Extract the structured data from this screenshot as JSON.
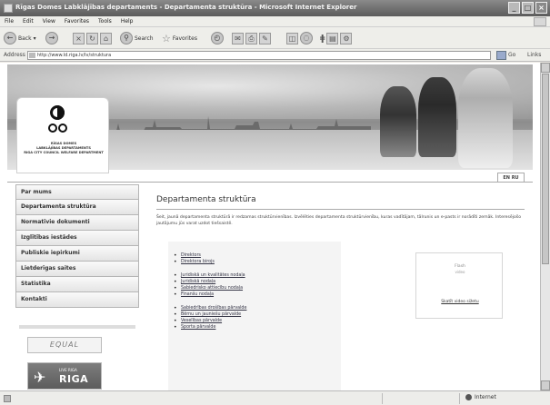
{
  "window": {
    "title": "Rīgas Domes Labklājības departaments  - Departamenta struktūra - Microsoft Internet Explorer",
    "buttons": {
      "minimize": "_",
      "maximize": "□",
      "close": "×"
    }
  },
  "menubar": {
    "items": [
      "File",
      "Edit",
      "View",
      "Favorites",
      "Tools",
      "Help"
    ]
  },
  "toolbar": {
    "back_label": "Back",
    "search_label": "Search",
    "favorites_label": "Favorites"
  },
  "address": {
    "label": "Address",
    "value": "http://www.ld.riga.lv/lv/struktura",
    "go_label": "Go",
    "links_label": "Links"
  },
  "logo": {
    "line1": "RĪGAS DOMES",
    "line2": "LABKLĀJĪBAS DEPARTAMENTS",
    "line3": "RIGA CITY COUNCIL WELFARE DEPARTMENT"
  },
  "lang_tab": "EN RU",
  "nav": {
    "items": [
      "Par mums",
      "Departamenta struktūra",
      "Normatīvie dokumenti",
      "Izglītības iestādes",
      "Publiskie iepirkumi",
      "Lietderīgas saites",
      "Statistika",
      "Kontakti"
    ]
  },
  "ads": {
    "ad1": "EQUAL",
    "ad2_small": "LIVE RIGA",
    "ad2_big": "RIGA"
  },
  "main": {
    "title": "Departamenta struktūra",
    "intro": "Šeit, jaunā departamenta struktūrā ir redzamas struktūrvienības. Izvēlēties departamenta struktūrvienību, kuras vadītājam, tālrunis un e-pasts ir norādīti zemāk. Interesējošo jautājumu jūs varat uzdot tiešsaistē.",
    "groups": [
      [
        "Direktors",
        "Direktora birojs"
      ],
      [
        "Juridiskā un kvalitātes nodaļa",
        "Juridiskā nodaļa",
        "Sabiedrisko attiecību nodaļa",
        "Finanšu nodaļa"
      ],
      [
        "Sabiedrības drošības pārvalde",
        "Bērnu un jauniešu pārvalde",
        "Veselības pārvalde",
        "Sporta pārvalde"
      ]
    ]
  },
  "video": {
    "line1": "Flash",
    "line2": "video",
    "link": "Skatīt video sižetu"
  },
  "status": {
    "zone": "Internet"
  }
}
